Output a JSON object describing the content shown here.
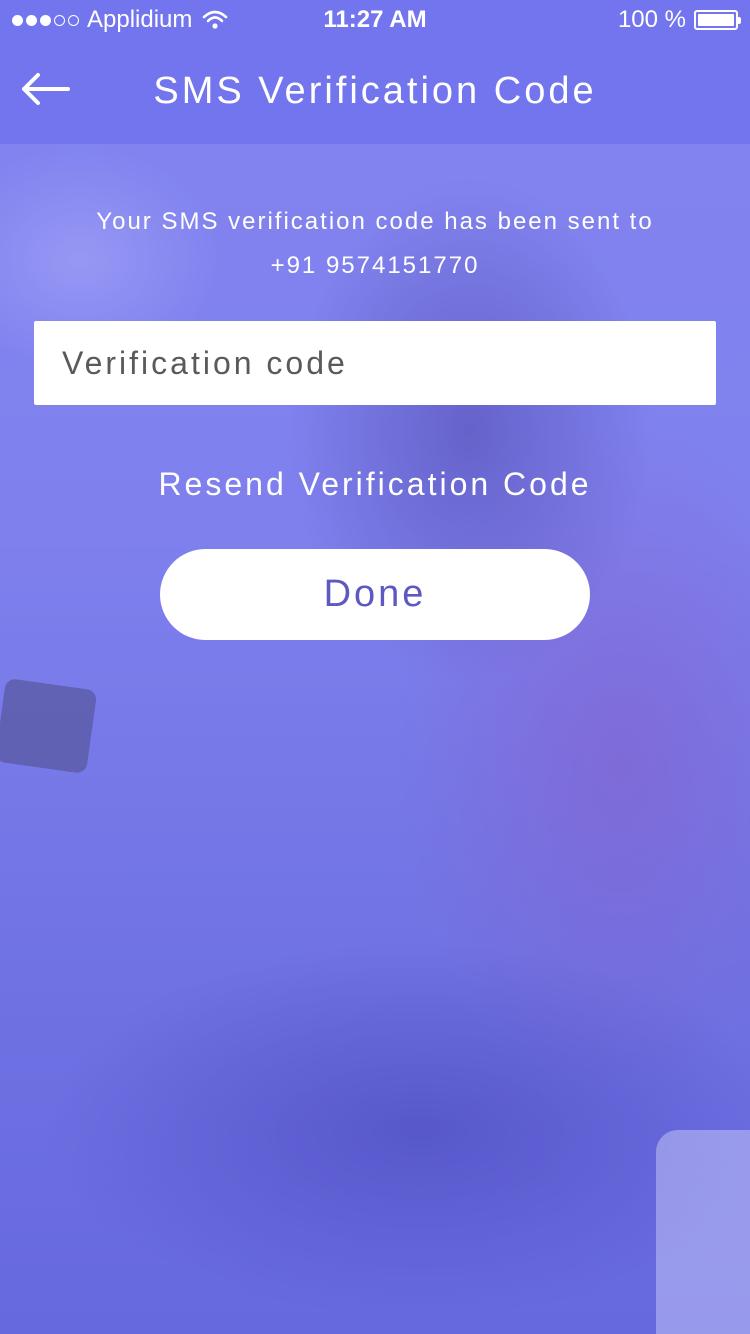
{
  "status_bar": {
    "carrier": "Applidium",
    "time": "11:27 AM",
    "battery": "100 %",
    "signal_strength": 3,
    "signal_max": 5
  },
  "nav": {
    "title": "SMS Verification Code",
    "back_icon": "arrow-left-icon"
  },
  "message": {
    "line1": "Your SMS verification code has been sent to",
    "phone": "+91 9574151770"
  },
  "form": {
    "code_placeholder": "Verification code",
    "code_value": "",
    "resend_label": "Resend Verification Code",
    "done_label": "Done"
  },
  "colors": {
    "nav_bar": "#7375ef",
    "accent_text": "#5e58c2",
    "overlay": "#8a8cf0"
  }
}
